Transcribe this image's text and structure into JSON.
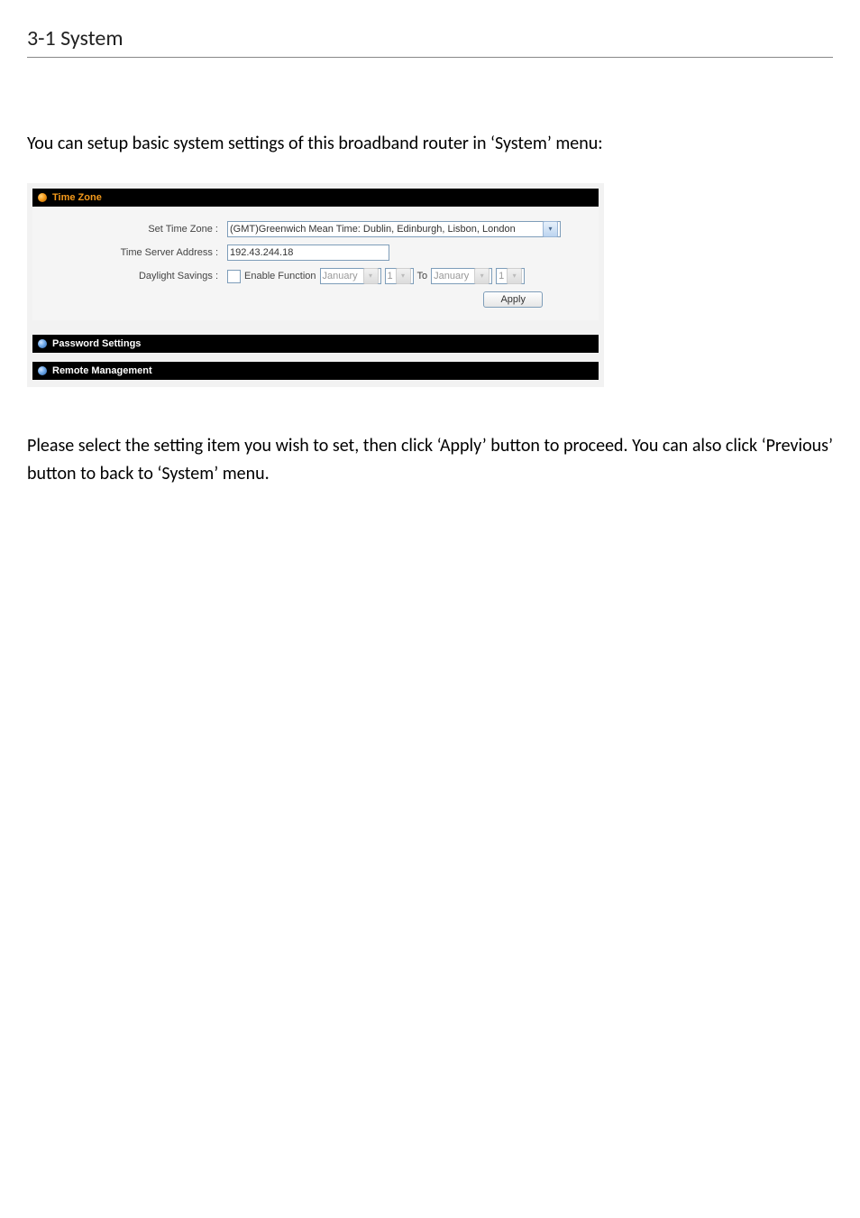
{
  "heading": "3-1 System",
  "intro_paragraph": "You can setup basic system settings of this broadband router in ‘System’ menu:",
  "router_ui": {
    "panels": {
      "time_zone": {
        "title": "Time Zone",
        "rows": {
          "set_time_zone": {
            "label": "Set Time Zone :",
            "select_value": "(GMT)Greenwich Mean Time: Dublin, Edinburgh, Lisbon, London"
          },
          "time_server": {
            "label": "Time Server Address :",
            "input_value": "192.43.244.18"
          },
          "daylight": {
            "label": "Daylight Savings :",
            "checkbox_label": "Enable Function",
            "from_month": "January",
            "from_day": "1",
            "to_label": "To",
            "to_month": "January",
            "to_day": "1"
          }
        },
        "apply_button": "Apply"
      },
      "password": {
        "title": "Password Settings"
      },
      "remote": {
        "title": "Remote Management"
      }
    }
  },
  "outro_paragraph": "Please select the setting item you wish to set, then click ‘Apply’ button to proceed. You can also click ‘Previous’ button to back to ‘System’ menu."
}
